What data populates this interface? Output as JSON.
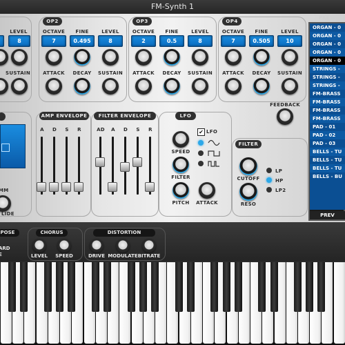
{
  "app": {
    "title": "FM-Synth 1"
  },
  "ops": [
    {
      "tag": "OP2",
      "octave": "7",
      "fine": "0.495",
      "level": "8"
    },
    {
      "tag": "OP3",
      "octave": "2",
      "fine": "0.5",
      "level": "8"
    },
    {
      "tag": "OP4",
      "octave": "7",
      "fine": "0.505",
      "level": "10"
    }
  ],
  "op1": {
    "level_label": "LEVEL",
    "level": "8",
    "sustain_label": "SUSTAIN"
  },
  "labels": {
    "octave": "OCTAVE",
    "fine": "FINE",
    "level": "LEVEL",
    "attack": "ATTACK",
    "decay": "DECAY",
    "sustain": "SUSTAIN",
    "feedback": "FEEDBACK",
    "amp_env": "AMP ENVELOPE",
    "filter_env": "FILTER ENVELOPE",
    "lfo": "LFO",
    "speed": "SPEED",
    "filter": "FILTER",
    "pitch": "PITCH",
    "filter_section": "FILTER",
    "cutoff": "CUTOFF",
    "reso": "RESO",
    "glide": "LIDE",
    "mm": "MM",
    "lp": "LP",
    "hp": "HP",
    "lp2": "LP2",
    "lfo_toggle": "LFO",
    "ad": "AD",
    "a": "A",
    "d": "D",
    "s": "S",
    "r": "R"
  },
  "presets": {
    "header": "PRESE",
    "items": [
      "ORGAN - 0",
      "ORGAN - 0",
      "ORGAN - 0",
      "ORGAN - 0",
      "ORGAN - 0",
      "STRINGS -",
      "STRINGS -",
      "STRINGS -",
      "FM-BRASS",
      "FM-BRASS",
      "FM-BRASS",
      "FM-BRASS",
      "PAD - 01",
      "PAD - 02",
      "PAD - 03",
      "BELLS - TU",
      "BELLS - TU",
      "BELLS - TU",
      "BELLS - BU"
    ],
    "selected_index": 4,
    "prev": "PREV"
  },
  "fx": {
    "transpose": "POSE",
    "keyboard": "ARD",
    "mode": "E",
    "chorus": "CHORUS",
    "level": "LEVEL",
    "speed": "SPEED",
    "distortion": "DISTORTION",
    "drive": "DRIVE",
    "modulate": "MODULATE",
    "bitrate": "BITRATE"
  },
  "colors": {
    "accent": "#2da8e8",
    "display": "#0a6cc0",
    "preset_bg": "#0b4f93"
  }
}
